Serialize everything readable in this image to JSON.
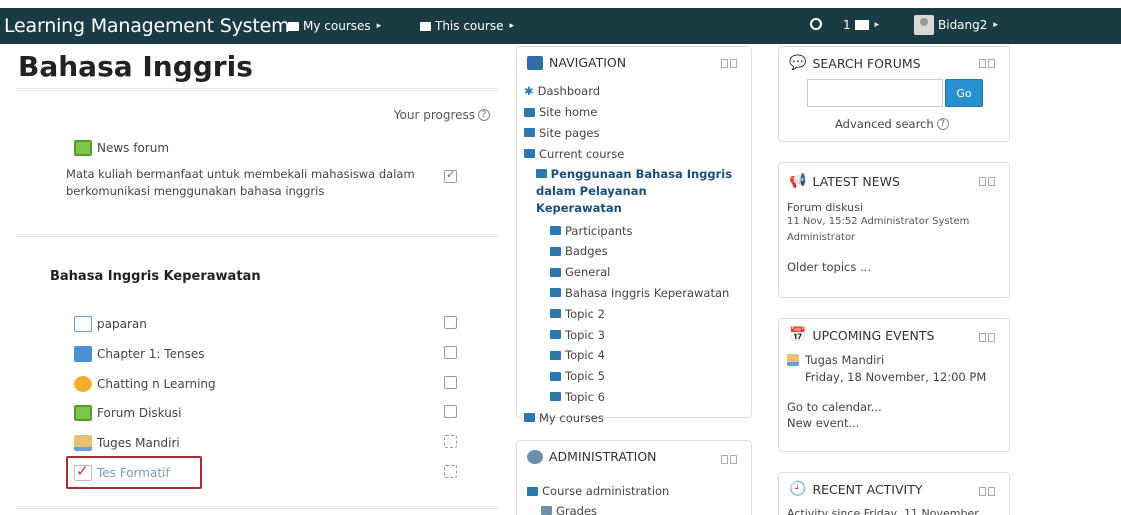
{
  "navbar": {
    "brand": "Learning Management System",
    "my_courses": "My courses",
    "this_course": "This course",
    "message_count": "1",
    "user": "Bidang2"
  },
  "course": {
    "title": "Bahasa Inggris",
    "your_progress": "Your progress",
    "news_forum": "News forum",
    "summary": "Mata kuliah bermanfaat untuk membekali mahasiswa dalam berkomunikasi menggunakan bahasa inggris",
    "section_title": "Bahasa Inggris Keperawatan",
    "activities": [
      {
        "label": "paparan",
        "icon": "page-icon"
      },
      {
        "label": "Chapter 1: Tenses",
        "icon": "folder-icon"
      },
      {
        "label": "Chatting n Learning",
        "icon": "chat-icon"
      },
      {
        "label": "Forum Diskusi",
        "icon": "forum-icon"
      },
      {
        "label": "Tuges Mandiri",
        "icon": "assignment-icon"
      },
      {
        "label": "Tes Formatif",
        "icon": "quiz-icon"
      }
    ]
  },
  "navigation": {
    "title": "NAVIGATION",
    "items": [
      {
        "label": "Dashboard"
      },
      {
        "label": "Site home"
      },
      {
        "label": "Site pages"
      },
      {
        "label": "Current course"
      },
      {
        "label": "Penggunaan Bahasa Inggris dalam Pelayanan Keperawatan"
      },
      {
        "label": "Participants"
      },
      {
        "label": "Badges"
      },
      {
        "label": "General"
      },
      {
        "label": "Bahasa Inggris Keperawatan"
      },
      {
        "label": "Topic 2"
      },
      {
        "label": "Topic 3"
      },
      {
        "label": "Topic 4"
      },
      {
        "label": "Topic 5"
      },
      {
        "label": "Topic 6"
      },
      {
        "label": "My courses"
      }
    ]
  },
  "administration": {
    "title": "ADMINISTRATION",
    "course_admin": "Course administration",
    "grades": "Grades"
  },
  "search_forums": {
    "title": "SEARCH FORUMS",
    "go": "Go",
    "advanced": "Advanced search"
  },
  "latest_news": {
    "title": "LATEST NEWS",
    "item_title": "Forum diskusi",
    "item_meta": "11 Nov, 15:52 Administrator System Administrator",
    "older": "Older topics ..."
  },
  "upcoming_events": {
    "title": "UPCOMING EVENTS",
    "event": "Tugas Mandiri",
    "date": "Friday, 18 November, 12:00 PM",
    "calendar": "Go to calendar...",
    "new_event": "New event..."
  },
  "recent_activity": {
    "title": "RECENT ACTIVITY",
    "since": "Activity since Friday, 11 November"
  }
}
